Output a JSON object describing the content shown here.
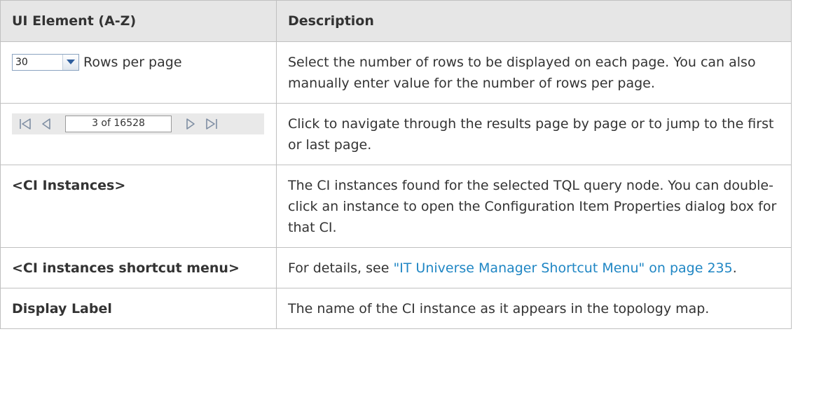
{
  "table": {
    "col_element": "UI Element (A-Z)",
    "col_description": "Description"
  },
  "rows": {
    "rows_per_page": {
      "value": "30",
      "label": "Rows per page",
      "description": "Select the number of rows to be displayed on each page. You can also manually enter value for the number of rows per page."
    },
    "pager": {
      "page_text": "3 of 16528",
      "description": "Click to navigate through the results page by page or to jump to the first or last page."
    },
    "ci_instances": {
      "element": "<CI Instances>",
      "description": "The CI instances found for the selected TQL query node. You can double-click an instance to open the Configuration Item Properties dialog box for that CI."
    },
    "ci_shortcut": {
      "element": "<CI instances shortcut menu>",
      "desc_prefix": "For details, see ",
      "link_text": "\"IT Universe Manager Shortcut Menu\" on page 235",
      "desc_suffix": "."
    },
    "display_label": {
      "element": "Display Label",
      "description": "The name of the CI instance as it appears in the topology map."
    }
  },
  "colors": {
    "header_bg": "#e6e6e6",
    "border": "#c0c0c0",
    "link": "#1f86c4",
    "text": "#333333"
  },
  "icons": {
    "combo_arrow": "chevron-down-icon",
    "first": "first-page-icon",
    "prev": "previous-page-icon",
    "next": "next-page-icon",
    "last": "last-page-icon"
  }
}
